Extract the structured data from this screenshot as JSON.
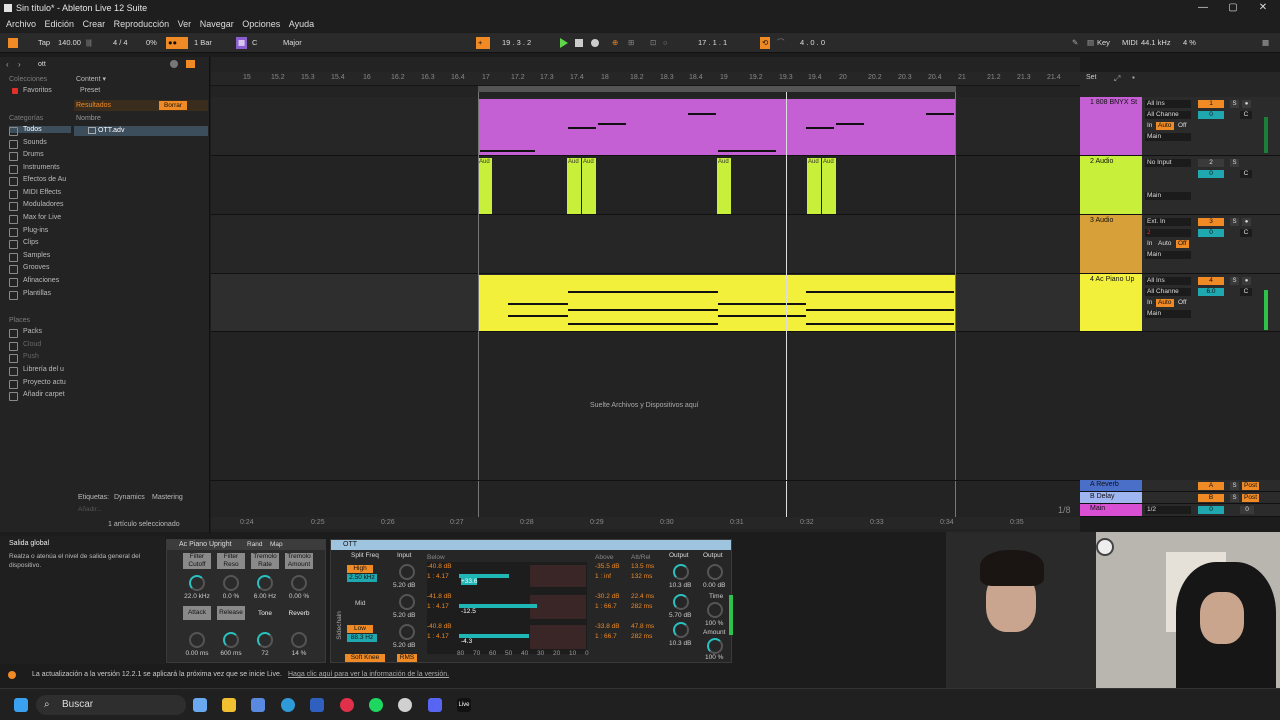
{
  "window": {
    "title": "Sin título* - Ableton Live 12 Suite",
    "min": "—",
    "max": "▢",
    "close": "✕"
  },
  "menu": [
    "Archivo",
    "Edición",
    "Crear",
    "Reproducción",
    "Ver",
    "Navegar",
    "Opciones",
    "Ayuda"
  ],
  "transport": {
    "tap": "Tap",
    "tempo": "140.00",
    "meter": "4 / 4",
    "pct": "0%",
    "quant": "1 Bar",
    "key": "C",
    "scale": "Major",
    "position": "19 .  3 .  2",
    "loop_start": "17 .  1 .  1",
    "loop_len": "4 .  0 .  0",
    "key_btn": "Key",
    "midi": "MIDI",
    "sample_rate": "44.1 kHz",
    "cpu": "4 %"
  },
  "browser": {
    "search": "ott",
    "colecciones": "Colecciones",
    "favoritos": "Favoritos",
    "content": "Content ▾",
    "preset": "Preset",
    "resultados": "Resultados",
    "borrar": "Borrar",
    "nombre": "Nombre",
    "result_item": "OTT.adv",
    "categorias": "Categorías",
    "cats": [
      "Todos",
      "Sounds",
      "Drums",
      "Instruments",
      "Efectos de Au",
      "MIDI Effects",
      "Moduladores",
      "Max for Live",
      "Plug-ins",
      "Clips",
      "Samples",
      "Grooves",
      "Afinaciones",
      "Plantillas"
    ],
    "lugares": "Places",
    "places": [
      "Packs",
      "Cloud",
      "Push",
      "Librería del u",
      "Proyecto actu",
      "Añadir carpet"
    ],
    "etiquetas": "Etiquetas:",
    "tag1": "Dynamics",
    "tag2": "Mastering",
    "anadir": "Añadir...",
    "selected": "1 artículo seleccionado"
  },
  "ruler": [
    "15",
    "15.2",
    "15.3",
    "15.4",
    "16",
    "16.2",
    "16.3",
    "16.4",
    "17",
    "17.2",
    "17.3",
    "17.4",
    "18",
    "18.2",
    "18.3",
    "18.4",
    "19",
    "19.2",
    "19.3",
    "19.4",
    "20",
    "20.2",
    "20.3",
    "20.4",
    "21",
    "21.2",
    "21.3",
    "21.4"
  ],
  "bottom_ruler": [
    "0:24",
    "0:25",
    "0:26",
    "0:27",
    "0:28",
    "0:29",
    "0:30",
    "0:31",
    "0:32",
    "0:33",
    "0:34",
    "0:35"
  ],
  "drop_text": "Suelte Archivos y Dispositivos aquí",
  "audio_clip_label": "Aud",
  "set_label": "Set",
  "zoom": "1/8",
  "tracks": [
    {
      "name": "1 808 BNYX St",
      "color": "#c45fd4",
      "input": "All Ins",
      "channel": "All Channe",
      "num": "1",
      "vol": "0",
      "pan": "C",
      "out": "Main"
    },
    {
      "name": "2 Audio",
      "color": "#c8f03a",
      "input": "No Input",
      "num": "2",
      "vol": "0",
      "pan": "C",
      "out": "Main"
    },
    {
      "name": "3 Audio",
      "color": "#d7a038",
      "input": "Ext. In",
      "channel": "2",
      "num": "3",
      "vol": "0",
      "pan": "C",
      "out": "Main"
    },
    {
      "name": "4 Ac Piano Up",
      "color": "#f2f03a",
      "input": "All Ins",
      "channel": "All Channe",
      "num": "4",
      "vol": "6.0",
      "pan": "C",
      "out": "Main"
    }
  ],
  "returns": [
    {
      "name": "A Reverb",
      "letter": "A",
      "post": "Post"
    },
    {
      "name": "B Delay",
      "letter": "B",
      "post": "Post"
    },
    {
      "name": "Main",
      "out": "1/2",
      "vol": "0",
      "pan": "0"
    }
  ],
  "monitor": {
    "in": "In",
    "auto": "Auto",
    "off": "Off"
  },
  "infopanel": {
    "title": "Salida global",
    "text": "Realza o atenúa el nivel de salida general del dispositivo."
  },
  "device1": {
    "name": "Ac Piano Upright",
    "rand": "Rand",
    "map": "Map",
    "labels": [
      "Filter Cutoff",
      "Filter Reso",
      "Tremolo Rate",
      "Tremolo Amount"
    ],
    "vals": [
      "22.0 kHz",
      "0.0 %",
      "6.00 Hz",
      "0.00 %"
    ],
    "labels2": [
      "Attack",
      "Release",
      "Tone",
      "Reverb"
    ],
    "vals2": [
      "0.00 ms",
      "600 ms",
      "72",
      "14 %"
    ]
  },
  "ott": {
    "name": "OTT",
    "split": "Split Freq",
    "input": "Input",
    "below": "Below",
    "above": "Above",
    "attrel": "Att/Rel",
    "output": "Output",
    "high": "High",
    "mid": "Mid",
    "low": "Low",
    "freq_high": "2.50 kHz",
    "freq_low": "88.3 Hz",
    "in_vals": [
      "5.20 dB",
      "5.20 dB",
      "5.20 dB"
    ],
    "below_vals": [
      "-40.8 dB",
      "1 : 4.17",
      "-41.8 dB",
      "1 : 4.17",
      "-40.8 dB",
      "1 : 4.17"
    ],
    "above_vals": [
      "-35.5 dB",
      "1 : inf",
      "-30.2 dB",
      "1 : 66.7",
      "-33.8 dB",
      "1 : 66.7"
    ],
    "att": [
      "13.5 ms",
      "132 ms",
      "22.4 ms",
      "282 ms",
      "47.8 ms",
      "282 ms"
    ],
    "out_vals": [
      "10.3 dB",
      "5.70 dB",
      "10.3 dB"
    ],
    "output2": "0.00 dB",
    "time": "Time",
    "time_val": "100 %",
    "amount": "Amount",
    "amount_val": "100 %",
    "bars": [
      "+33.6",
      "-12.5",
      "-4.3"
    ],
    "scale": [
      "80",
      "70",
      "60",
      "50",
      "40",
      "30",
      "20",
      "10",
      "0"
    ],
    "soft_knee": "Soft Knee",
    "rms": "RMS",
    "sidechain": "Sidechain"
  },
  "status": {
    "text": "La actualización a la versión 12.2.1 se aplicará la próxima vez que se inicie Live.",
    "link": "Haga clic aquí para ver la información de la versión."
  },
  "taskbar": {
    "search": "Buscar",
    "live": "Live"
  }
}
